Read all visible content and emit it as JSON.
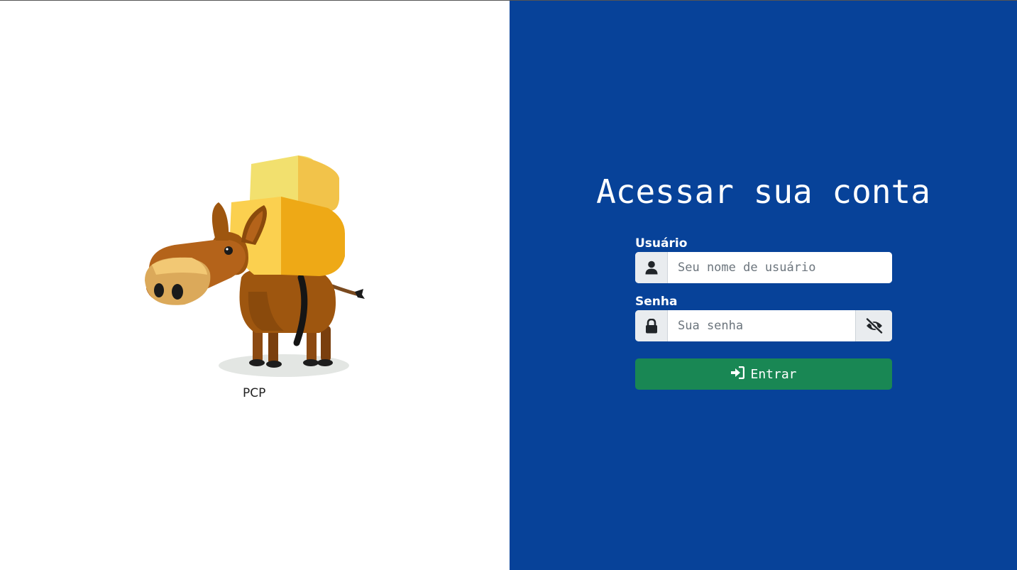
{
  "brand": {
    "name": "PCP"
  },
  "login": {
    "title": "Acessar sua conta",
    "username": {
      "label": "Usuário",
      "placeholder": "Seu nome de usuário",
      "icon": "user-icon"
    },
    "password": {
      "label": "Senha",
      "placeholder": "Sua senha",
      "icon": "lock-icon",
      "toggle_icon": "eye-slash-icon"
    },
    "submit_label": "Entrar",
    "submit_icon": "sign-in-icon"
  },
  "colors": {
    "panel_bg": "#074299",
    "button_bg": "#198754",
    "addon_bg": "#e9ecef"
  }
}
